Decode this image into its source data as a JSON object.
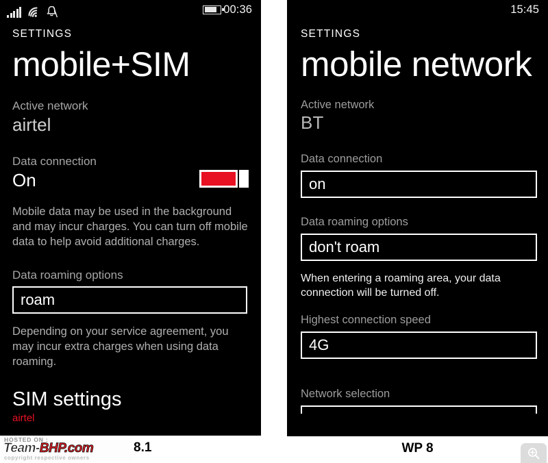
{
  "page": {
    "background": "#ffffff",
    "accent_red": "#e81123"
  },
  "left_phone": {
    "caption": "WP 8.1",
    "status_bar": {
      "signal_icon": "signal-bars-icon",
      "wifi_icon": "wifi-icon",
      "notification_icon": "bell-muted-icon",
      "battery_icon": "battery-icon",
      "battery_level": "68%",
      "time": "00:36"
    },
    "header": {
      "app_title": "SETTINGS",
      "page_title": "mobile+SIM"
    },
    "active_network": {
      "label": "Active network",
      "value": "airtel"
    },
    "data_connection": {
      "label": "Data connection",
      "value": "On",
      "toggle_state": "on",
      "toggle_color": "#e81123",
      "description": "Mobile data may be used in the background and may incur charges. You can turn off mobile data to help avoid additional charges."
    },
    "data_roaming": {
      "label": "Data roaming options",
      "value": "roam",
      "description": "Depending on your service agreement, you may incur extra charges when using data roaming."
    },
    "sim_settings": {
      "title": "SIM settings",
      "subtitle": "airtel",
      "subtitle_color": "#e81123"
    }
  },
  "right_phone": {
    "caption": "WP 8",
    "status_bar": {
      "time": "15:45"
    },
    "header": {
      "app_title": "SETTINGS",
      "page_title": "mobile network"
    },
    "active_network": {
      "label": "Active network",
      "value": "BT"
    },
    "data_connection": {
      "label": "Data connection",
      "value": "on"
    },
    "data_roaming": {
      "label": "Data roaming options",
      "value": "don't roam",
      "description": "When entering a roaming area, your data connection will be turned off."
    },
    "connection_speed": {
      "label": "Highest connection speed",
      "value": "4G"
    },
    "network_selection": {
      "label": "Network selection"
    }
  },
  "watermark": {
    "hosted_on": "HOSTED ON :",
    "brand_team": "Team-",
    "brand_bhp": "BHP.com",
    "copyright": "copyright respective owners"
  },
  "zoom_control": {
    "icon": "magnifier-plus-icon"
  }
}
